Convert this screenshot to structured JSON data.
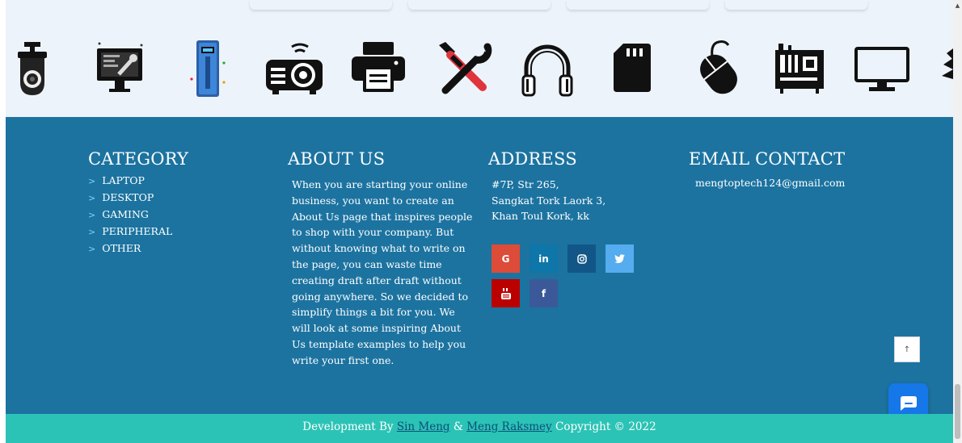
{
  "icons": [
    "cctv-camera-icon",
    "computer-repair-icon",
    "ups-icon",
    "projector-icon",
    "printer-icon",
    "tools-icon",
    "headphones-icon",
    "sd-card-icon",
    "mouse-icon",
    "motherboard-icon",
    "monitor-icon",
    "wifi-icon"
  ],
  "category": {
    "title": "CATEGORY",
    "items": [
      "LAPTOP",
      "DESKTOP",
      "GAMING",
      "PERIPHERAL",
      "OTHER"
    ]
  },
  "about": {
    "title": "ABOUT US",
    "text": "When you are starting your online business, you want to create an About Us page that inspires people to shop with your company. But without knowing what to write on the page, you can waste time creating draft after draft without going anywhere. So we decided to simplify things a bit for you. We will look at some inspiring About Us template examples to help you write your first one."
  },
  "address": {
    "title": "ADDRESS",
    "line1": "#7P, Str 265,",
    "line2": "Sangkat Tork Laork 3,",
    "line3": "Khan Toul Kork, kk"
  },
  "email": {
    "title": "EMAIL CONTACT",
    "value": "mengtoptech124@gmail.com"
  },
  "social": {
    "google": "G",
    "linkedin": "in",
    "instagram": "instagram-icon",
    "twitter": "twitter-icon",
    "youtube": "youtube-icon",
    "facebook": "f",
    "colors": {
      "google": "#dd4b39",
      "linkedin": "#0e76a8",
      "instagram": "#125688",
      "twitter": "#55acee",
      "youtube": "#bb0000",
      "facebook": "#3b5998"
    }
  },
  "back_to_top": "↑",
  "footer": {
    "prefix": "Development By",
    "author1": "Sin Meng",
    "amp": "&",
    "author2": "Meng Raksmey",
    "suffix": "Copyright © 2022"
  },
  "scrollbar": {
    "up": "▲"
  }
}
